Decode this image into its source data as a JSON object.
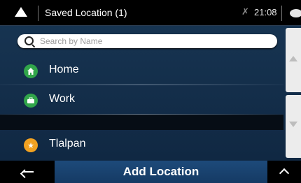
{
  "header": {
    "title": "Saved Location (1)",
    "time": "21:08"
  },
  "search": {
    "placeholder": "Search by Name"
  },
  "locations": [
    {
      "label": "Home",
      "icon": "home-icon",
      "color": "#31a54a"
    },
    {
      "label": "Work",
      "icon": "briefcase-icon",
      "color": "#31a54a"
    },
    {
      "label": "Tlalpan",
      "icon": "star-icon",
      "color": "#f2a221"
    }
  ],
  "footer": {
    "add_label": "Add Location"
  }
}
